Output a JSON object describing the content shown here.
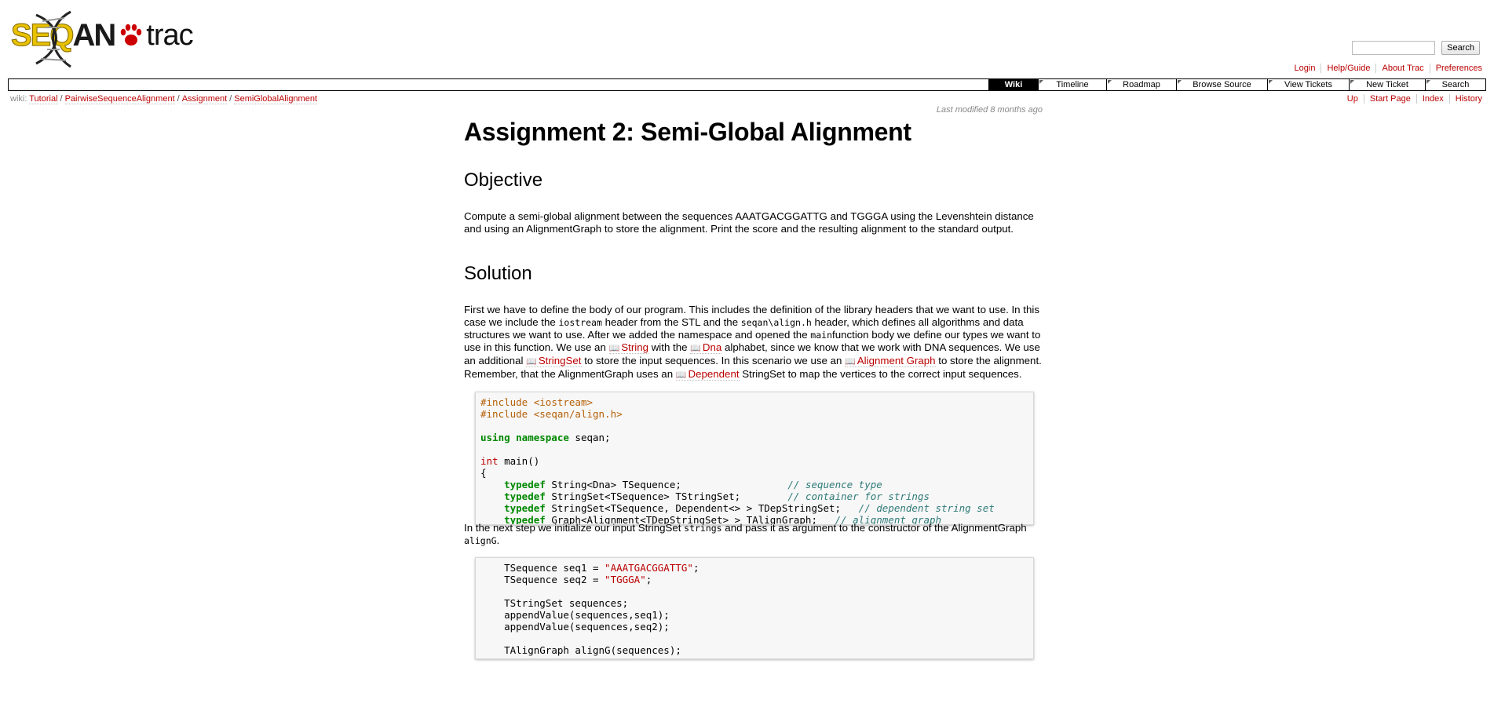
{
  "logo": {
    "seqan_seq": "SEQ",
    "seqan_an": "AN",
    "trac": "trac"
  },
  "search": {
    "placeholder": "",
    "button_label": "Search"
  },
  "metanav": [
    {
      "label": "Login"
    },
    {
      "label": "Help/Guide"
    },
    {
      "label": "About Trac"
    },
    {
      "label": "Preferences"
    }
  ],
  "mainnav": [
    {
      "label": "Wiki",
      "active": true
    },
    {
      "label": "Timeline"
    },
    {
      "label": "Roadmap"
    },
    {
      "label": "Browse Source"
    },
    {
      "label": "View Tickets"
    },
    {
      "label": "New Ticket"
    },
    {
      "label": "Search"
    }
  ],
  "breadcrumb": {
    "prefix": "wiki:",
    "items": [
      "Tutorial",
      "PairwiseSequenceAlignment",
      "Assignment",
      "SemiGlobalAlignment"
    ],
    "separator": "/"
  },
  "ctxtnav": [
    {
      "label": "Up"
    },
    {
      "label": "Start Page"
    },
    {
      "label": "Index"
    },
    {
      "label": "History"
    }
  ],
  "page": {
    "last_modified": "Last modified 8 months ago",
    "title": "Assignment 2: Semi-Global Alignment",
    "objective_heading": "Objective",
    "objective_text": "Compute a semi-global alignment between the sequences AAATGACGGATTG and TGGGA using the Levenshtein distance and using an AlignmentGraph to store the alignment. Print the score and the resulting alignment to the standard output.",
    "solution_heading": "Solution",
    "solution_p1": {
      "t1": "First we have to define the body of our program. This includes the definition of the library headers that we want to use. In this case we include the ",
      "c1": "iostream",
      "t2": " header from the STL and the ",
      "c2": "seqan\\align.h",
      "t3": " header, which defines all algorithms and data structures we want to use. After we added the namespace and opened the ",
      "c3": "main",
      "t4": "function body we define our types we want to use in this function. We use an ",
      "l1": "String",
      "t5": " with the ",
      "l2": "Dna",
      "t6": " alphabet, since we know that we work with DNA sequences. We use an additional ",
      "l3": "StringSet",
      "t7": " to store the input sequences. In this scenario we use an ",
      "l4": "Alignment Graph",
      "t8": " to store the alignment. Remember, that the AlignmentGraph uses an ",
      "l5": "Dependent",
      "t9": " StringSet to map the vertices to the correct input sequences."
    },
    "solution_p2": {
      "t1": "In the next step we initialize our input StringSet ",
      "c1": "strings",
      "t2": " and pass it as argument to the constructor of the AlignmentGraph ",
      "c2": "alignG",
      "t3": "."
    }
  },
  "code1": {
    "inc1_kw": "#include",
    "inc1_file": "<iostream>",
    "inc2_kw": "#include",
    "inc2_file": "<seqan/align.h>",
    "using_kw": "using namespace",
    "using_rest": " seqan;",
    "int_kw": "int",
    "main_rest": " main()",
    "brace": "{",
    "l1_kw": "typedef",
    "l1_code": " String<Dna> TSequence;",
    "l1_cm": "// sequence type",
    "l2_kw": "typedef",
    "l2_code": " StringSet<TSequence> TStringSet;",
    "l2_cm": "// container for strings",
    "l3_kw": "typedef",
    "l3_code": " StringSet<TSequence, Dependent<> > TDepStringSet;",
    "l3_cm": "// dependent string set",
    "l4_kw": "typedef",
    "l4_code": " Graph<Alignment<TDepStringSet> > TAlignGraph;",
    "l4_cm": "// alignment graph"
  },
  "code2": {
    "s1_pre": "TSequence seq1 = ",
    "s1_str": "\"AAATGACGGATTG\"",
    "s1_post": ";",
    "s2_pre": "TSequence seq2 = ",
    "s2_str": "\"TGGGA\"",
    "s2_post": ";",
    "l3": "TStringSet sequences;",
    "l4": "appendValue(sequences,seq1);",
    "l5": "appendValue(sequences,seq2);",
    "l6": "TAlignGraph alignG(sequences);"
  },
  "colors": {
    "link": "#bb0000",
    "keyword": "#008800",
    "comment": "#2e7a77",
    "preprocessor": "#b45f06"
  }
}
